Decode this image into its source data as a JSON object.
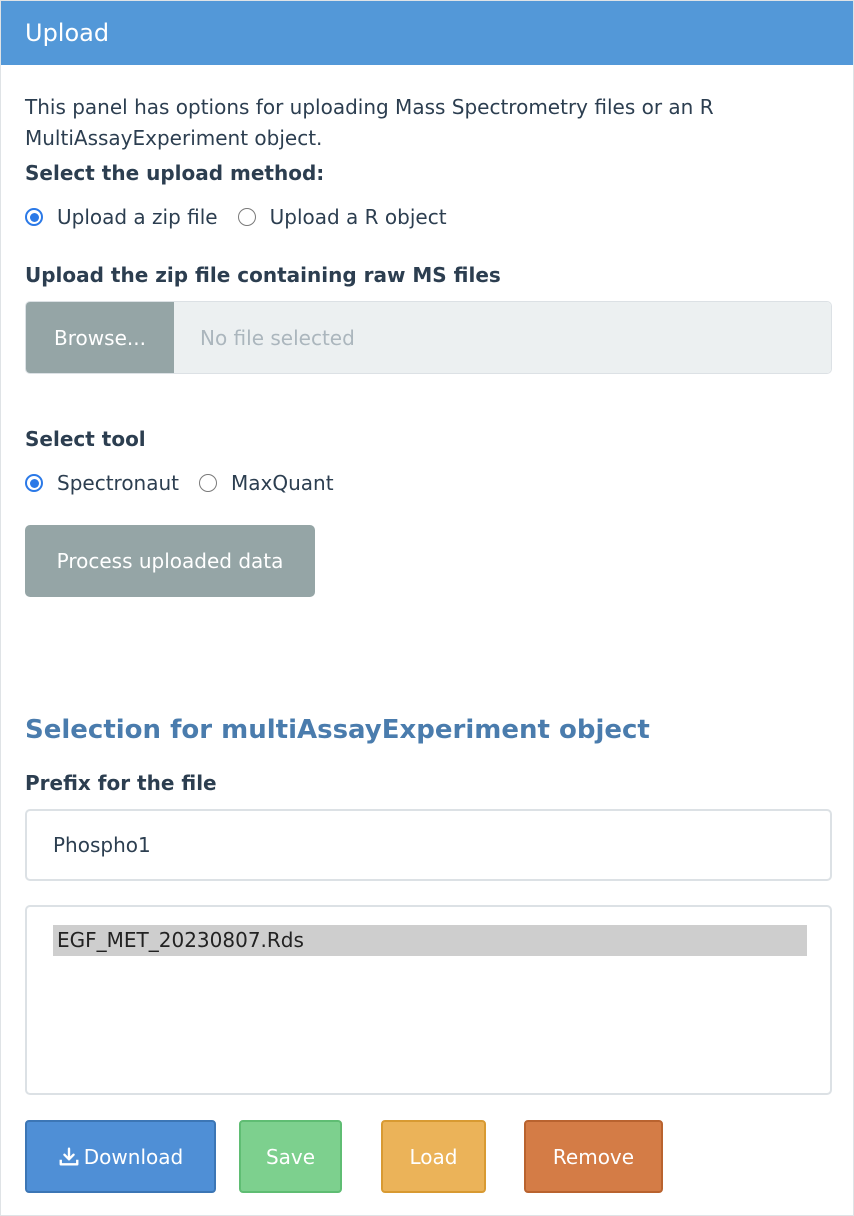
{
  "header": {
    "title": "Upload"
  },
  "description": "This panel has options for uploading Mass Spectrometry files or an R MultiAssayExperiment object.",
  "upload_method": {
    "label": "Select the upload method:",
    "options": [
      {
        "label": "Upload a zip file",
        "checked": true
      },
      {
        "label": "Upload a R object",
        "checked": false
      }
    ]
  },
  "zip_upload": {
    "label": "Upload the zip file containing raw MS files",
    "browse_label": "Browse...",
    "placeholder": "No file selected"
  },
  "tool": {
    "label": "Select tool",
    "options": [
      {
        "label": "Spectronaut",
        "checked": true
      },
      {
        "label": "MaxQuant",
        "checked": false
      }
    ]
  },
  "process_button": "Process uploaded data",
  "mae_section": {
    "title": "Selection for multiAssayExperiment object",
    "prefix_label": "Prefix for the file",
    "prefix_value": "Phospho1",
    "files": [
      "EGF_MET_20230807.Rds"
    ]
  },
  "actions": {
    "download": "Download",
    "save": "Save",
    "load": "Load",
    "remove": "Remove"
  },
  "colors": {
    "header": "#5398d8",
    "section_title": "#4a7cad",
    "download": "#4f8fd6",
    "save": "#7dd08e",
    "load": "#ebb359",
    "remove": "#d47c46",
    "radio_checked": "#2b79e7"
  }
}
